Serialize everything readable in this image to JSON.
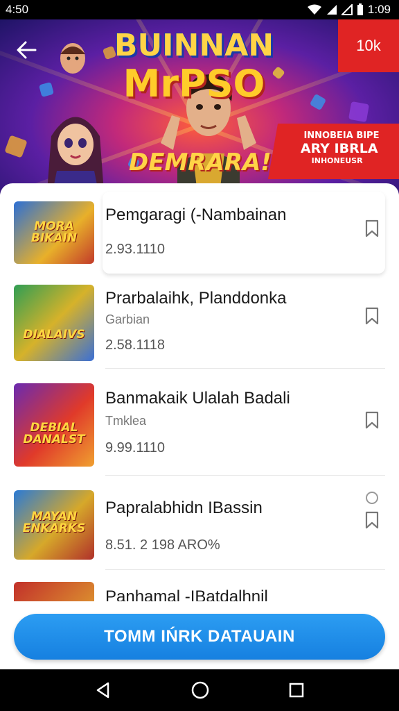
{
  "status_bar": {
    "time_left": "4:50",
    "time_right": "1:09"
  },
  "hero": {
    "title_line1": "BUINNAN",
    "title_line2": "MrPSO",
    "subtitle": "DEMRARA!",
    "promo_line1": "INNOBEIA BIPE",
    "promo_line2": "ARY IBRLA",
    "promo_line3": "INHONEUSR",
    "badge": "10k"
  },
  "items": [
    {
      "title": "Pemgaragi (-Nambainan",
      "subtitle": "",
      "meta": "2.93.1110",
      "thumb_text": "MORA BIKAIN"
    },
    {
      "title": "Prarbalaihk, Planddonka",
      "subtitle": "Garbian",
      "meta": "2.58.1118",
      "thumb_text": "DIALAIVS"
    },
    {
      "title": "Banmakaik Ulalah Badali",
      "subtitle": "Tmklea",
      "meta": "9.99.1110",
      "thumb_text": "DEBIAL DANALST"
    },
    {
      "title": "Papralabhidn IBassin",
      "subtitle": "",
      "meta": "8.51. 2 198 ARO%",
      "thumb_text": "MAYAN ENKARKS"
    },
    {
      "title": "Panhamal -IBatdalhnil",
      "subtitle": "",
      "meta": "",
      "thumb_text": ""
    }
  ],
  "cta": {
    "label": "TOMM IŃRK DATAUAIN"
  },
  "colors": {
    "accent": "#1e8ae8",
    "badge_red": "#e02424",
    "nav": "#000000"
  },
  "icons": {
    "back": "arrow-left-icon",
    "bookmark": "bookmark-icon",
    "nav_back": "triangle-back-icon",
    "nav_home": "circle-home-icon",
    "nav_recent": "square-recent-icon"
  }
}
